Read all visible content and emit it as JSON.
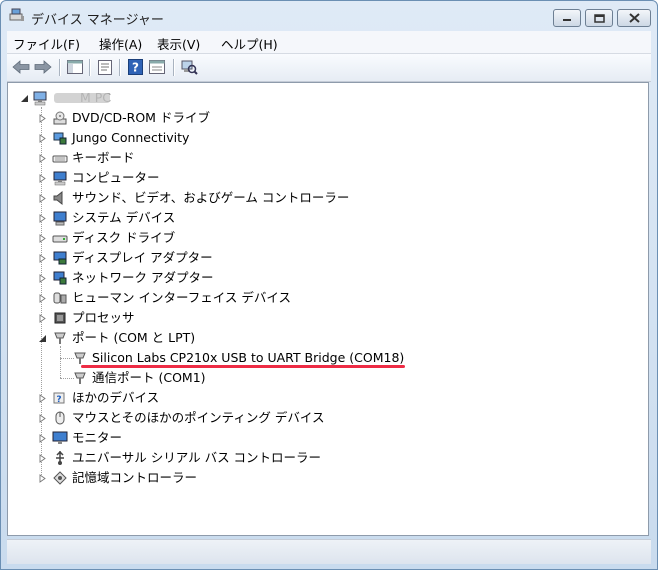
{
  "window": {
    "title": "デバイス マネージャー"
  },
  "menu": [
    "ファイル(F)",
    "操作(A)",
    "表示(V)",
    "ヘルプ(H)"
  ],
  "toolbar": [
    {
      "name": "back-arrow-icon"
    },
    {
      "name": "forward-arrow-icon"
    },
    {
      "name": "show-hide-console-tree-icon"
    },
    {
      "name": "properties-icon"
    },
    {
      "name": "help-icon"
    },
    {
      "name": "update-driver-icon"
    },
    {
      "name": "scan-hardware-icon"
    }
  ],
  "tree": {
    "root": {
      "label": "M PC",
      "icon": "computer-icon"
    },
    "categories": [
      {
        "label": "DVD/CD-ROM ドライブ",
        "icon": "dvd-drive-icon"
      },
      {
        "label": "Jungo Connectivity",
        "icon": "network-device-icon"
      },
      {
        "label": "キーボード",
        "icon": "keyboard-icon"
      },
      {
        "label": "コンピューター",
        "icon": "computer-icon"
      },
      {
        "label": "サウンド、ビデオ、およびゲーム コントローラー",
        "icon": "speaker-icon"
      },
      {
        "label": "システム デバイス",
        "icon": "system-device-icon"
      },
      {
        "label": "ディスク ドライブ",
        "icon": "disk-drive-icon"
      },
      {
        "label": "ディスプレイ アダプター",
        "icon": "display-adapter-icon"
      },
      {
        "label": "ネットワーク アダプター",
        "icon": "network-adapter-icon"
      },
      {
        "label": "ヒューマン インターフェイス デバイス",
        "icon": "hid-icon"
      },
      {
        "label": "プロセッサ",
        "icon": "processor-icon"
      },
      {
        "label": "ポート (COM と LPT)",
        "icon": "port-icon",
        "expanded": true,
        "children": [
          {
            "label": "Silicon Labs CP210x USB to UART Bridge (COM18)",
            "icon": "port-icon",
            "highlighted": true
          },
          {
            "label": "通信ポート (COM1)",
            "icon": "port-icon"
          }
        ]
      },
      {
        "label": "ほかのデバイス",
        "icon": "unknown-device-icon"
      },
      {
        "label": "マウスとそのほかのポインティング デバイス",
        "icon": "mouse-icon"
      },
      {
        "label": "モニター",
        "icon": "monitor-icon"
      },
      {
        "label": "ユニバーサル シリアル バス コントローラー",
        "icon": "usb-icon"
      },
      {
        "label": "記憶域コントローラー",
        "icon": "storage-controller-icon"
      }
    ]
  },
  "colors": {
    "highlight_underline": "#ee2c45",
    "window_frame": "#c9dbee"
  }
}
